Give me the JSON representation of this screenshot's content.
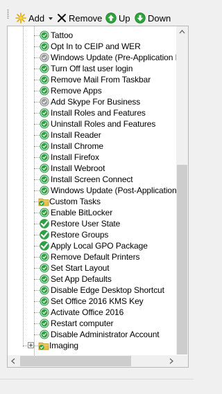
{
  "toolbar": {
    "add_label": "Add",
    "remove_label": "Remove",
    "up_label": "Up",
    "down_label": "Down"
  },
  "tree": {
    "items": [
      {
        "label": "Tattoo",
        "icon": "check-green"
      },
      {
        "label": "Opt In to CEIP and WER",
        "icon": "check-green"
      },
      {
        "label": "Windows Update (Pre-Application Inst",
        "icon": "check-gray"
      },
      {
        "label": "Turn Off last user login",
        "icon": "check-green"
      },
      {
        "label": "Remove Mail From Taskbar",
        "icon": "check-green"
      },
      {
        "label": "Remove Apps",
        "icon": "check-green"
      },
      {
        "label": "Add Skype For Business",
        "icon": "check-gray"
      },
      {
        "label": "Install Roles and Features",
        "icon": "check-green"
      },
      {
        "label": "Uninstall Roles and Features",
        "icon": "check-green"
      },
      {
        "label": "Install Reader",
        "icon": "check-green"
      },
      {
        "label": "Install Chrome",
        "icon": "check-green"
      },
      {
        "label": "Install Firefox",
        "icon": "check-green"
      },
      {
        "label": "Install Webroot",
        "icon": "check-green"
      },
      {
        "label": "Install Screen Connect",
        "icon": "check-green"
      },
      {
        "label": "Windows Update (Post-Application Ins",
        "icon": "check-green"
      },
      {
        "label": "Custom Tasks",
        "icon": "folder-check"
      },
      {
        "label": "Enable BitLocker",
        "icon": "check-green"
      },
      {
        "label": "Restore User State",
        "icon": "check-big"
      },
      {
        "label": "Restore Groups",
        "icon": "check-big"
      },
      {
        "label": "Apply Local GPO Package",
        "icon": "check-big"
      },
      {
        "label": "Remove Default Printers",
        "icon": "check-green"
      },
      {
        "label": "Set Start Layout",
        "icon": "check-green"
      },
      {
        "label": "Set App Defaults",
        "icon": "check-green"
      },
      {
        "label": "Disable Edge Desktop Shortcut",
        "icon": "check-green"
      },
      {
        "label": "Set Office 2016 KMS Key",
        "icon": "check-green"
      },
      {
        "label": "Activate Office 2016",
        "icon": "check-green"
      },
      {
        "label": "Restart computer",
        "icon": "check-green"
      },
      {
        "label": "Disable Administrator Account",
        "icon": "check-green"
      },
      {
        "label": "Imaging",
        "icon": "folder-check"
      }
    ]
  },
  "colors": {
    "check_green": "#2ea043",
    "check_gray": "#9a9a9a",
    "folder_yellow": "#e8c04a"
  }
}
